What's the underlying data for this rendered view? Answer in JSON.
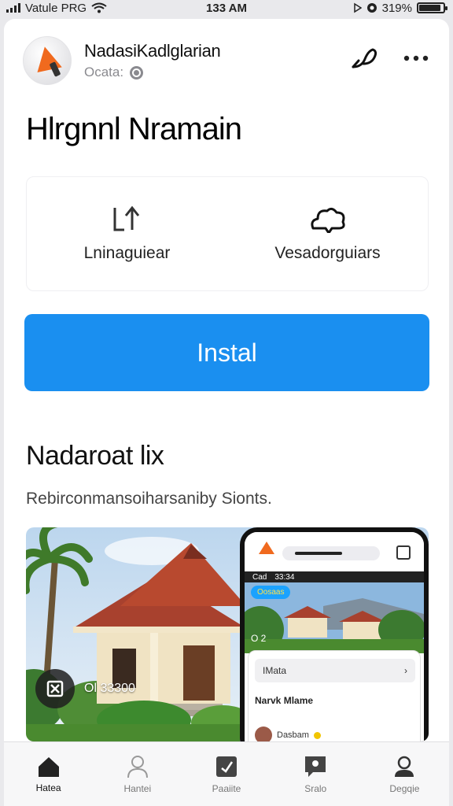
{
  "status_bar": {
    "carrier": "Vatule PRG",
    "time": "133 AM",
    "battery": "319%",
    "battery_level": 0.9
  },
  "app": {
    "name": "NadasiKadlglarian",
    "subtitle": "Ocata:"
  },
  "main_title": "Hlrgnnl Nramain",
  "features": [
    {
      "icon": "chart-arrow-icon",
      "label": "Lninaguiear"
    },
    {
      "icon": "cloud-icon",
      "label": "Vesadorguiars"
    }
  ],
  "install": {
    "label": "Instal"
  },
  "section": {
    "title": "Nadaroat lix",
    "subtitle": "Rebirconmansoiharsaniby Sionts."
  },
  "screenshots": {
    "counter": "Ol 33300",
    "phone": {
      "status": [
        "Cad",
        "33:34"
      ],
      "pill": "Oosaas",
      "counter": "O 2",
      "sheet_row1": "IMata",
      "sheet_row2": "Narvk Mlame",
      "sheet_row3": "Dasbam"
    }
  },
  "bottom_nav": [
    {
      "icon": "home-icon",
      "label": "Hatea",
      "active": true
    },
    {
      "icon": "person-icon",
      "label": "Hantei",
      "active": false
    },
    {
      "icon": "tag-icon",
      "label": "Paaiite",
      "active": false
    },
    {
      "icon": "chat-icon",
      "label": "Sralo",
      "active": false
    },
    {
      "icon": "profile-icon",
      "label": "Degqie",
      "active": false
    }
  ],
  "colors": {
    "accent": "#1a8ff0",
    "icon_orange": "#f06a1e"
  }
}
